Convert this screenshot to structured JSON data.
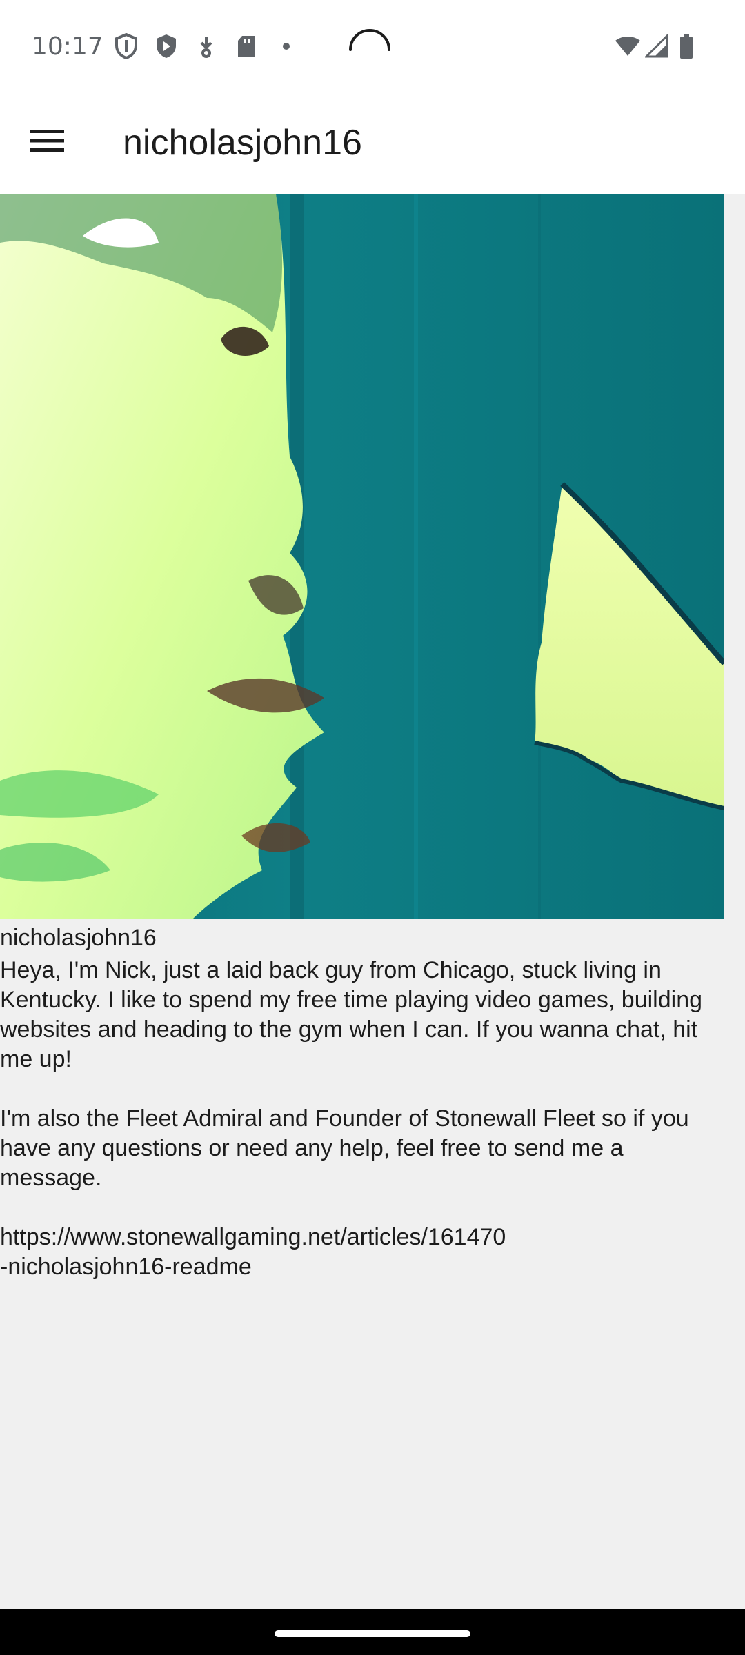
{
  "status_bar": {
    "time": "10:17",
    "icons": [
      "shield-outline-icon",
      "shield-play-icon",
      "download-icon",
      "sd-card-icon",
      "dot-icon",
      "loading-spinner-icon",
      "wifi-icon",
      "signal-icon",
      "battery-icon"
    ]
  },
  "app_bar": {
    "menu_icon": "hamburger-menu-icon",
    "title": "nicholasjohn16"
  },
  "profile": {
    "image_alt": "profile-photo",
    "name": "nicholasjohn16",
    "bio": "Heya, I'm Nick, just a laid back guy from Chicago, stuck living in Kentucky. I like to spend my free time playing video games, building websites and heading to the gym when I can. If you wanna chat, hit me up!\n\nI'm also the Fleet Admiral and Founder of Stonewall Fleet so if you have any questions or need any help, feel free to send me a message.\n\nhttps://www.stonewallgaming.net/articles/161470\n-nicholasjohn16-readme"
  },
  "colors": {
    "status_bar_bg": "#ffffff",
    "app_bar_bg": "#ffffff",
    "content_bg": "#f0f0f0",
    "photo_teal": "#0e7f86",
    "photo_lime": "#e6ffb0",
    "nav_bar_bg": "#000000"
  }
}
